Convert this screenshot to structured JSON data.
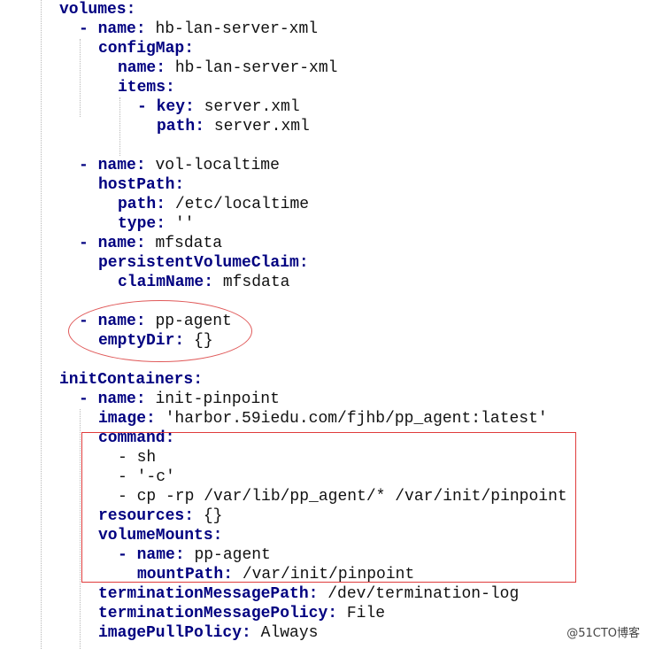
{
  "editor": {
    "lines": [
      {
        "indent": 0,
        "dash": "",
        "key": "volumes",
        "value": ""
      },
      {
        "indent": 2,
        "dash": "- ",
        "key": "name",
        "value": " hb-lan-server-xml"
      },
      {
        "indent": 4,
        "dash": "",
        "key": "configMap",
        "value": ""
      },
      {
        "indent": 6,
        "dash": "",
        "key": "name",
        "value": " hb-lan-server-xml"
      },
      {
        "indent": 6,
        "dash": "",
        "key": "items",
        "value": ""
      },
      {
        "indent": 8,
        "dash": "- ",
        "key": "key",
        "value": " server.xml"
      },
      {
        "indent": 10,
        "dash": "",
        "key": "path",
        "value": " server.xml"
      },
      {
        "indent": 0,
        "dash": "",
        "key": "",
        "value": ""
      },
      {
        "indent": 2,
        "dash": "- ",
        "key": "name",
        "value": " vol-localtime"
      },
      {
        "indent": 4,
        "dash": "",
        "key": "hostPath",
        "value": ""
      },
      {
        "indent": 6,
        "dash": "",
        "key": "path",
        "value": " /etc/localtime"
      },
      {
        "indent": 6,
        "dash": "",
        "key": "type",
        "value": " ''"
      },
      {
        "indent": 2,
        "dash": "- ",
        "key": "name",
        "value": " mfsdata"
      },
      {
        "indent": 4,
        "dash": "",
        "key": "persistentVolumeClaim",
        "value": ""
      },
      {
        "indent": 6,
        "dash": "",
        "key": "claimName",
        "value": " mfsdata"
      },
      {
        "indent": 0,
        "dash": "",
        "key": "",
        "value": ""
      },
      {
        "indent": 2,
        "dash": "- ",
        "key": "name",
        "value": " pp-agent"
      },
      {
        "indent": 4,
        "dash": "",
        "key": "emptyDir",
        "value": " {}"
      },
      {
        "indent": 0,
        "dash": "",
        "key": "",
        "value": ""
      },
      {
        "indent": 0,
        "dash": "",
        "key": "initContainers",
        "value": ""
      },
      {
        "indent": 2,
        "dash": "- ",
        "key": "name",
        "value": " init-pinpoint"
      },
      {
        "indent": 4,
        "dash": "",
        "key": "image",
        "value": " 'harbor.59iedu.com/fjhb/pp_agent:latest'"
      },
      {
        "indent": 4,
        "dash": "",
        "key": "command",
        "value": ""
      },
      {
        "indent": 6,
        "dash": "",
        "key": "",
        "value": "- sh"
      },
      {
        "indent": 6,
        "dash": "",
        "key": "",
        "value": "- '-c'"
      },
      {
        "indent": 6,
        "dash": "",
        "key": "",
        "value": "- cp -rp /var/lib/pp_agent/* /var/init/pinpoint"
      },
      {
        "indent": 4,
        "dash": "",
        "key": "resources",
        "value": " {}"
      },
      {
        "indent": 4,
        "dash": "",
        "key": "volumeMounts",
        "value": ""
      },
      {
        "indent": 6,
        "dash": "- ",
        "key": "name",
        "value": " pp-agent"
      },
      {
        "indent": 8,
        "dash": "",
        "key": "mountPath",
        "value": " /var/init/pinpoint"
      },
      {
        "indent": 4,
        "dash": "",
        "key": "terminationMessagePath",
        "value": " /dev/termination-log"
      },
      {
        "indent": 4,
        "dash": "",
        "key": "terminationMessagePolicy",
        "value": " File"
      },
      {
        "indent": 4,
        "dash": "",
        "key": "imagePullPolicy",
        "value": " Always"
      }
    ]
  },
  "colors": {
    "key": "#000080",
    "value": "#111111",
    "annotation": "#e03c3c"
  },
  "watermark": "@51CTO博客"
}
